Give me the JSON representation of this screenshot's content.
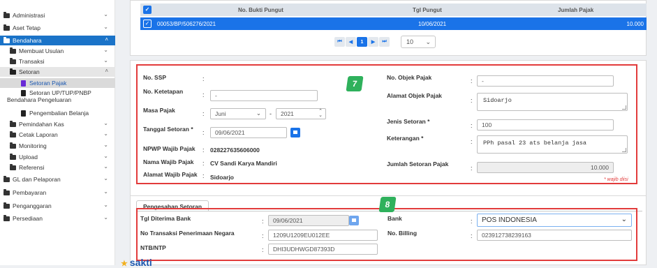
{
  "sidebar": {
    "items": [
      {
        "label": "Administrasi"
      },
      {
        "label": "Aset Tetap"
      },
      {
        "label": "Bendahara"
      },
      {
        "label": "Membuat Usulan"
      },
      {
        "label": "Transaksi"
      },
      {
        "label": "Setoran"
      },
      {
        "label": "Setoran Pajak"
      },
      {
        "label_line1": "Setoran UP/TUP/PNBP",
        "label_line2": "Bendahara Pengeluaran"
      },
      {
        "label": "Pengembalian Belanja"
      },
      {
        "label": "Pemindahan Kas"
      },
      {
        "label": "Cetak Laporan"
      },
      {
        "label": "Monitoring"
      },
      {
        "label": "Upload"
      },
      {
        "label": "Referensi"
      },
      {
        "label": "GL dan Pelaporan"
      },
      {
        "label": "Pembayaran"
      },
      {
        "label": "Penganggaran"
      },
      {
        "label": "Persediaan"
      }
    ]
  },
  "table": {
    "headers": [
      "No. Bukti Pungut",
      "Tgl Pungut",
      "Jumlah Pajak"
    ],
    "rows": [
      {
        "no_bukti": "00053/BP/506276/2021",
        "tgl": "10/06/2021",
        "jumlah": "10.000"
      }
    ],
    "pager": {
      "first": "⏮",
      "prev": "◀",
      "current": "1",
      "next": "▶",
      "last": "⏭",
      "page_size": "10"
    }
  },
  "annotations": {
    "badge_7": "7",
    "badge_8": "8"
  },
  "form": {
    "no_ssp_label": "No. SSP",
    "no_ketetapan_label": "No. Ketetapan",
    "no_ketetapan_value": "-",
    "masa_pajak_label": "Masa Pajak",
    "masa_bulan": "Juni",
    "masa_sep": "-",
    "masa_tahun": "2021",
    "tanggal_setoran_label": "Tanggal Setoran *",
    "tanggal_setoran_value": "09/06/2021",
    "npwp_label": "NPWP Wajib Pajak",
    "npwp_value": "028227635606000",
    "nama_label": "Nama Wajib Pajak",
    "nama_value": "CV Sandi Karya Mandiri",
    "alamat_label": "Alamat Wajib Pajak",
    "alamat_value": "Sidoarjo",
    "no_objek_label": "No. Objek Pajak",
    "no_objek_value": "-",
    "alamat_objek_label": "Alamat Objek Pajak",
    "alamat_objek_value": "Sidoarjo",
    "jenis_setoran_label": "Jenis Setoran *",
    "jenis_setoran_value": "100",
    "keterangan_label": "Keterangan *",
    "keterangan_value": "PPh pasal 23 ats belanja jasa",
    "jumlah_setoran_label": "Jumlah Setoran Pajak",
    "jumlah_setoran_value": "10.000",
    "required_note": "* wajib diisi"
  },
  "pengesahan": {
    "tab_label": "Pengesahan Setoran",
    "tgl_diterima_label": "Tgl Diterima Bank",
    "tgl_diterima_value": "09/06/2021",
    "no_transaksi_label": "No Transaksi Penerimaan Negara",
    "no_transaksi_value": "1209U1209EU012EE",
    "ntb_label": "NTB/NTP",
    "ntb_value": "DHI3UDHWGD87393D",
    "bank_label": "Bank",
    "bank_value": "POS INDONESIA",
    "no_billing_label": "No. Billing",
    "no_billing_value": "023912738239163"
  },
  "footer": {
    "logo": "sakti"
  },
  "colors": {
    "primary": "#1a73e8",
    "annotation_red": "#e23b3b",
    "badge_green": "#2fb15c"
  }
}
